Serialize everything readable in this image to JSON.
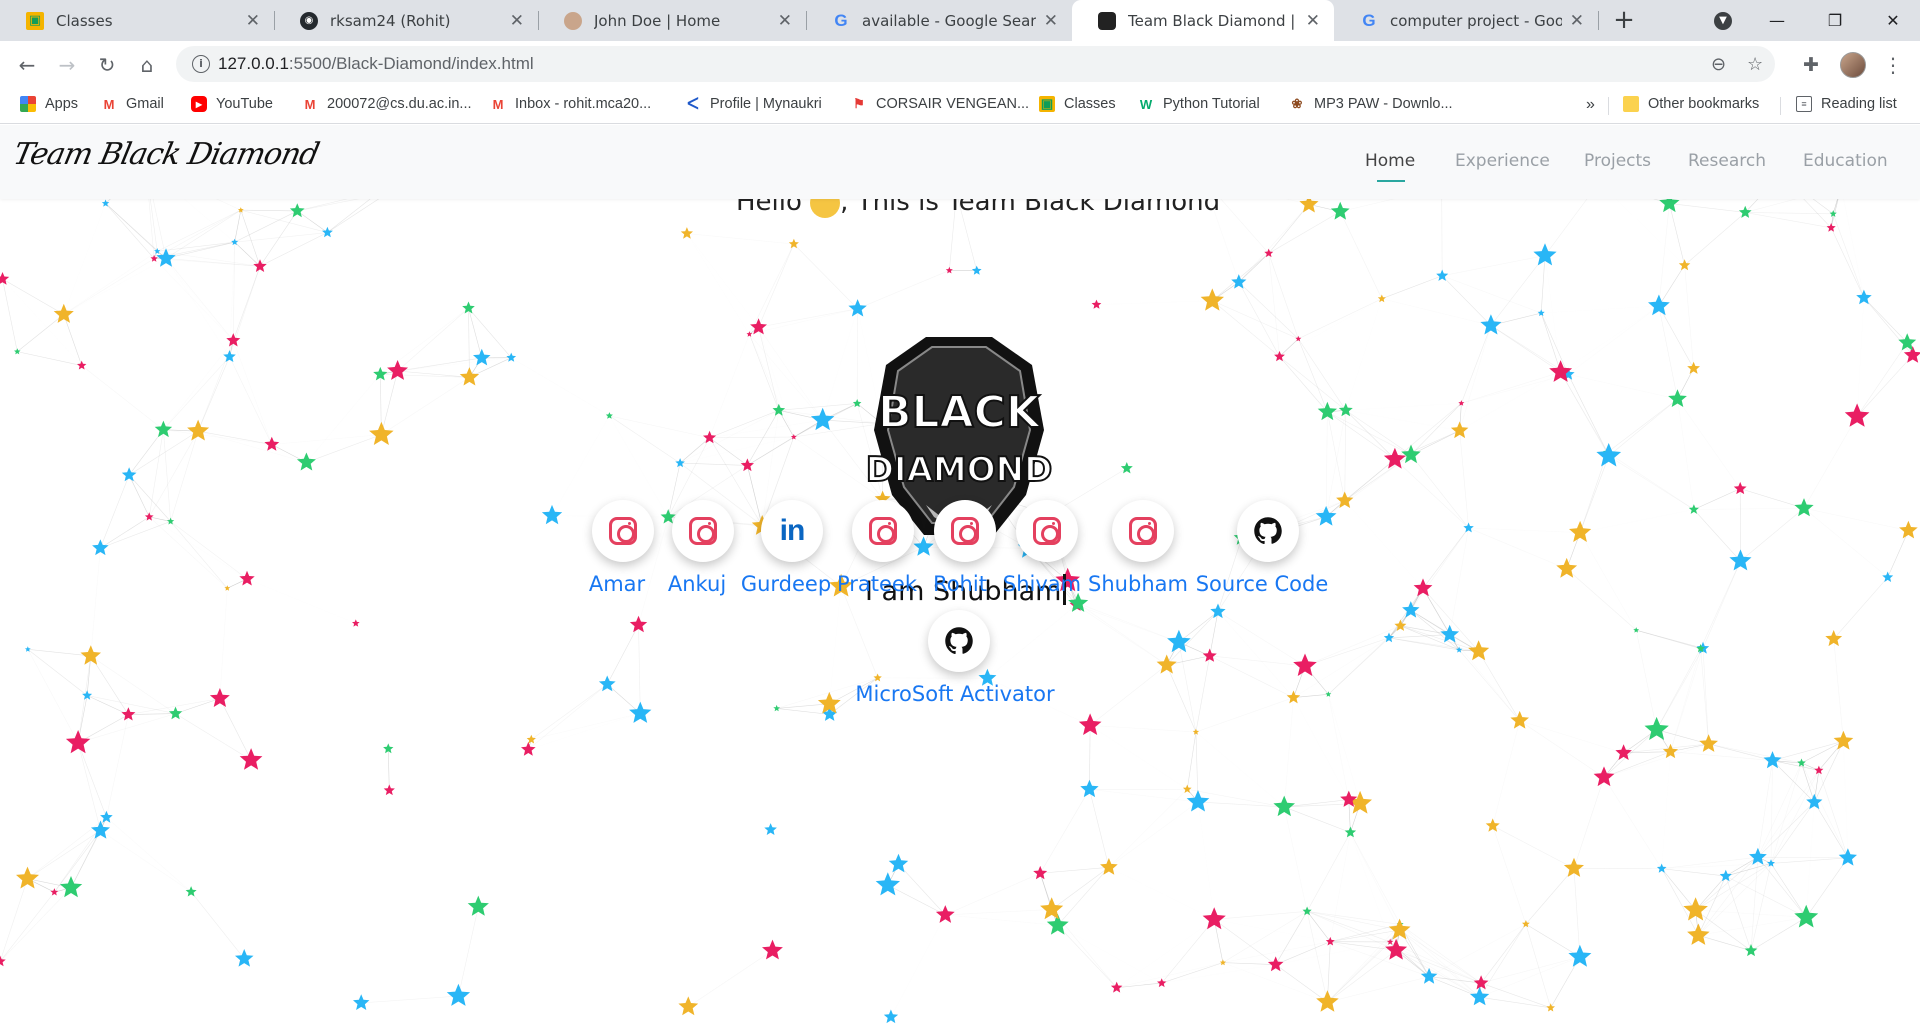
{
  "browser": {
    "tabs": [
      {
        "title": "Classes",
        "icon": "classroom-icon",
        "active": false
      },
      {
        "title": "rksam24 (Rohit)",
        "icon": "github-icon",
        "active": false
      },
      {
        "title": "John Doe | Home",
        "icon": "avatar-icon",
        "active": false
      },
      {
        "title": "available - Google Search",
        "icon": "google-icon",
        "active": false
      },
      {
        "title": "Team Black Diamond | Home",
        "icon": "site-favicon-icon",
        "active": true
      },
      {
        "title": "computer project - Google",
        "icon": "google-icon",
        "active": false
      }
    ],
    "new_tab": "+",
    "url_host": "127.0.0.1",
    "url_path": ":5500/Black-Diamond/index.html",
    "bookmarks": [
      {
        "label": "Apps",
        "icon": "apps-grid-icon"
      },
      {
        "label": "Gmail",
        "icon": "gmail-icon"
      },
      {
        "label": "YouTube",
        "icon": "youtube-icon"
      },
      {
        "label": "200072@cs.du.ac.in...",
        "icon": "gmail-icon"
      },
      {
        "label": "Inbox - rohit.mca20...",
        "icon": "gmail-icon"
      },
      {
        "label": "Profile | Mynaukri",
        "icon": "naukri-icon"
      },
      {
        "label": "CORSAIR VENGEAN...",
        "icon": "corsair-icon"
      },
      {
        "label": "Classes",
        "icon": "classroom-icon"
      },
      {
        "label": "Python Tutorial",
        "icon": "w3-icon"
      },
      {
        "label": "MP3 PAW - Downlo...",
        "icon": "paw-icon"
      }
    ],
    "bookmarks_overflow": "»",
    "other_bookmarks": "Other bookmarks",
    "reading_list": "Reading list"
  },
  "site": {
    "logo_text": "Team Black Diamond",
    "nav": [
      {
        "label": "Home",
        "active": true
      },
      {
        "label": "Experience",
        "active": false
      },
      {
        "label": "Projects",
        "active": false
      },
      {
        "label": "Research",
        "active": false
      },
      {
        "label": "Education",
        "active": false
      }
    ],
    "hello_prefix": "Hello",
    "hello_suffix": ", This is",
    "team_name": "Team Black Diamond",
    "emblem_line1": "BLACK",
    "emblem_line2": "DIAMOND",
    "typing_text": "I am Shubham",
    "socials": [
      {
        "name": "Amar",
        "icon": "instagram-icon"
      },
      {
        "name": "Ankuj",
        "icon": "instagram-icon"
      },
      {
        "name": "Gurdeep",
        "icon": "linkedin-icon"
      },
      {
        "name": "Prateek",
        "icon": "instagram-icon"
      },
      {
        "name": "Rohit",
        "icon": "instagram-icon"
      },
      {
        "name": "Shivam",
        "icon": "instagram-icon"
      },
      {
        "name": "Shubham",
        "icon": "instagram-icon"
      },
      {
        "name": "Source Code",
        "icon": "github-icon"
      },
      {
        "name": "MicroSoft Activator",
        "icon": "github-icon"
      }
    ],
    "star_colors": [
      "#e91e63",
      "#2ecc71",
      "#29b6f6",
      "#f0b42a"
    ],
    "link_color": "#1877f2"
  }
}
